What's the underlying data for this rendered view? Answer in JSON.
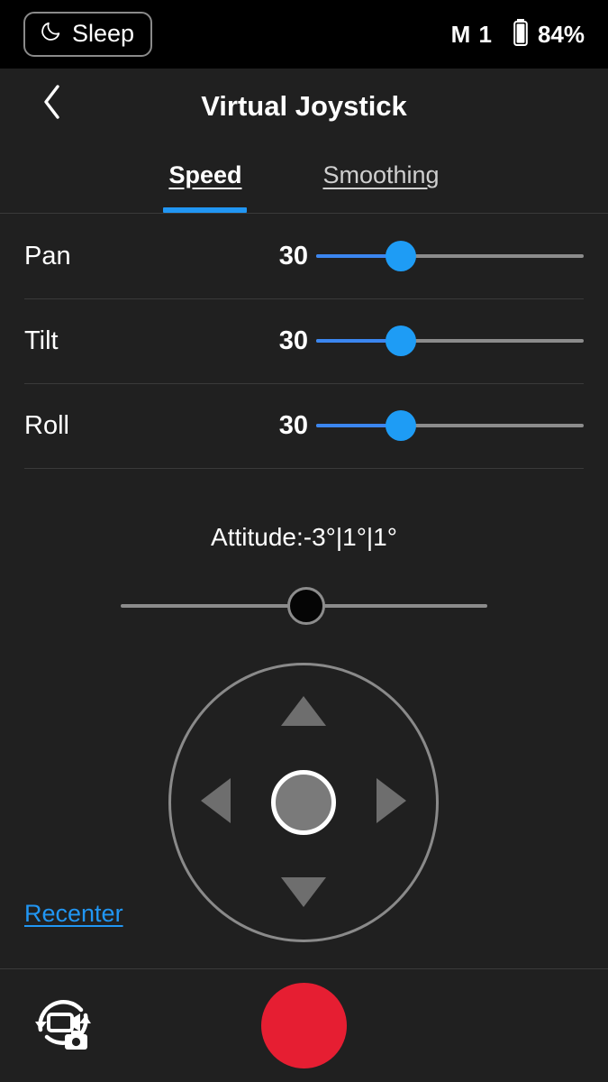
{
  "status_bar": {
    "sleep_button_label": "Sleep",
    "sleep_icon": "moon-icon",
    "mode_text": "M 1",
    "battery_icon": "battery-icon",
    "battery_percent": "84%"
  },
  "header": {
    "back_icon": "chevron-left-icon",
    "title": "Virtual Joystick"
  },
  "tabs": {
    "items": [
      {
        "label": "Speed",
        "active": true
      },
      {
        "label": "Smoothing",
        "active": false
      }
    ],
    "active_indicator_color": "#2196f3"
  },
  "speed_settings": {
    "rows": [
      {
        "label": "Pan",
        "value": "30",
        "fill_percent": 31
      },
      {
        "label": "Tilt",
        "value": "30",
        "fill_percent": 31
      },
      {
        "label": "Roll",
        "value": "30",
        "fill_percent": 31
      }
    ]
  },
  "attitude": {
    "readout": "Attitude:-3°|1°|1°",
    "slider_position_percent": 50
  },
  "joystick": {
    "up_icon": "triangle-up-icon",
    "down_icon": "triangle-down-icon",
    "left_icon": "triangle-left-icon",
    "right_icon": "triangle-right-icon",
    "center_icon": "joystick-knob"
  },
  "recenter": {
    "label": "Recenter",
    "color": "#2196f3"
  },
  "bottom_bar": {
    "mode_toggle_icon": "switch-photo-video-icon",
    "record_button_icon": "record-button",
    "record_color": "#e61e32"
  }
}
